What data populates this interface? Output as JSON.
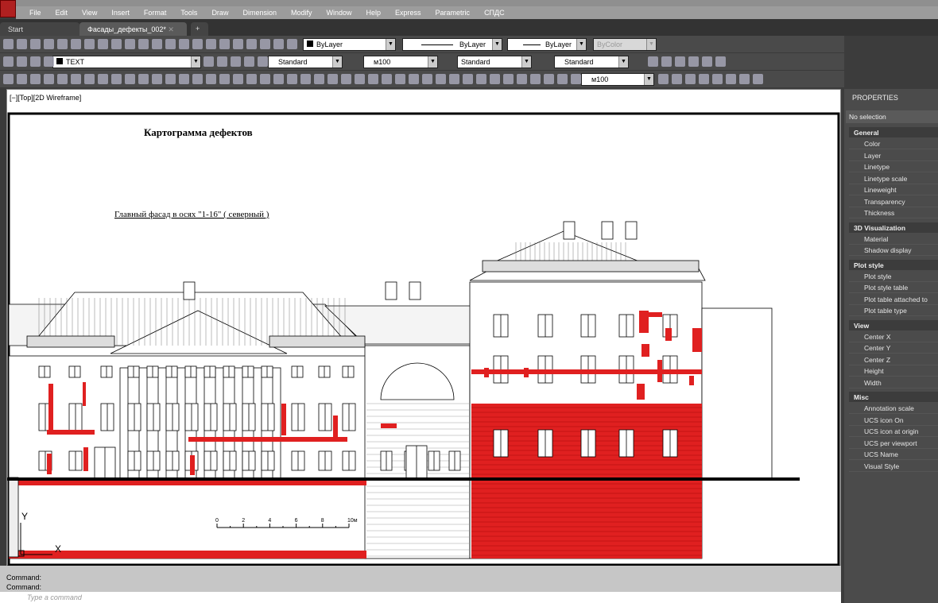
{
  "menu": [
    "File",
    "Edit",
    "View",
    "Insert",
    "Format",
    "Tools",
    "Draw",
    "Dimension",
    "Modify",
    "Window",
    "Help",
    "Express",
    "Parametric",
    "СПДС"
  ],
  "tabs": {
    "start": "Start",
    "active": "Фасады_дефекты_002*",
    "new": "+"
  },
  "toolbar": {
    "color": "ByLayer",
    "linetype": "ByLayer",
    "lineweight": "ByLayer",
    "plotstyle": "ByColor",
    "layer": "TEXT",
    "textstyle": "Standard",
    "dimstyle": "м100",
    "tablestyle": "Standard",
    "mleaderstyle": "Standard",
    "scale": "м100"
  },
  "viewport": {
    "label": "[−][Top][2D Wireframe]"
  },
  "drawing": {
    "title": "Картограмма дефектов",
    "subtitle": "Главный фасад в осях \"1-16\" ( северный )",
    "scale_ticks": [
      "0",
      "2",
      "4",
      "6",
      "8",
      "10м"
    ],
    "ucs_x": "X",
    "ucs_y": "Y"
  },
  "colors": {
    "defect": "#e02020"
  },
  "properties": {
    "title": "PROPERTIES",
    "selection": "No selection",
    "sections": [
      {
        "name": "General",
        "items": [
          "Color",
          "Layer",
          "Linetype",
          "Linetype scale",
          "Lineweight",
          "Transparency",
          "Thickness"
        ]
      },
      {
        "name": "3D Visualization",
        "items": [
          "Material",
          "Shadow display"
        ]
      },
      {
        "name": "Plot style",
        "items": [
          "Plot style",
          "Plot style table",
          "Plot table attached to",
          "Plot table type"
        ]
      },
      {
        "name": "View",
        "items": [
          "Center X",
          "Center Y",
          "Center Z",
          "Height",
          "Width"
        ]
      },
      {
        "name": "Misc",
        "items": [
          "Annotation scale",
          "UCS icon On",
          "UCS icon at origin",
          "UCS per viewport",
          "UCS Name",
          "Visual Style"
        ]
      }
    ]
  },
  "command": {
    "history": [
      "Command:",
      "Command:"
    ],
    "placeholder": "Type a command"
  }
}
